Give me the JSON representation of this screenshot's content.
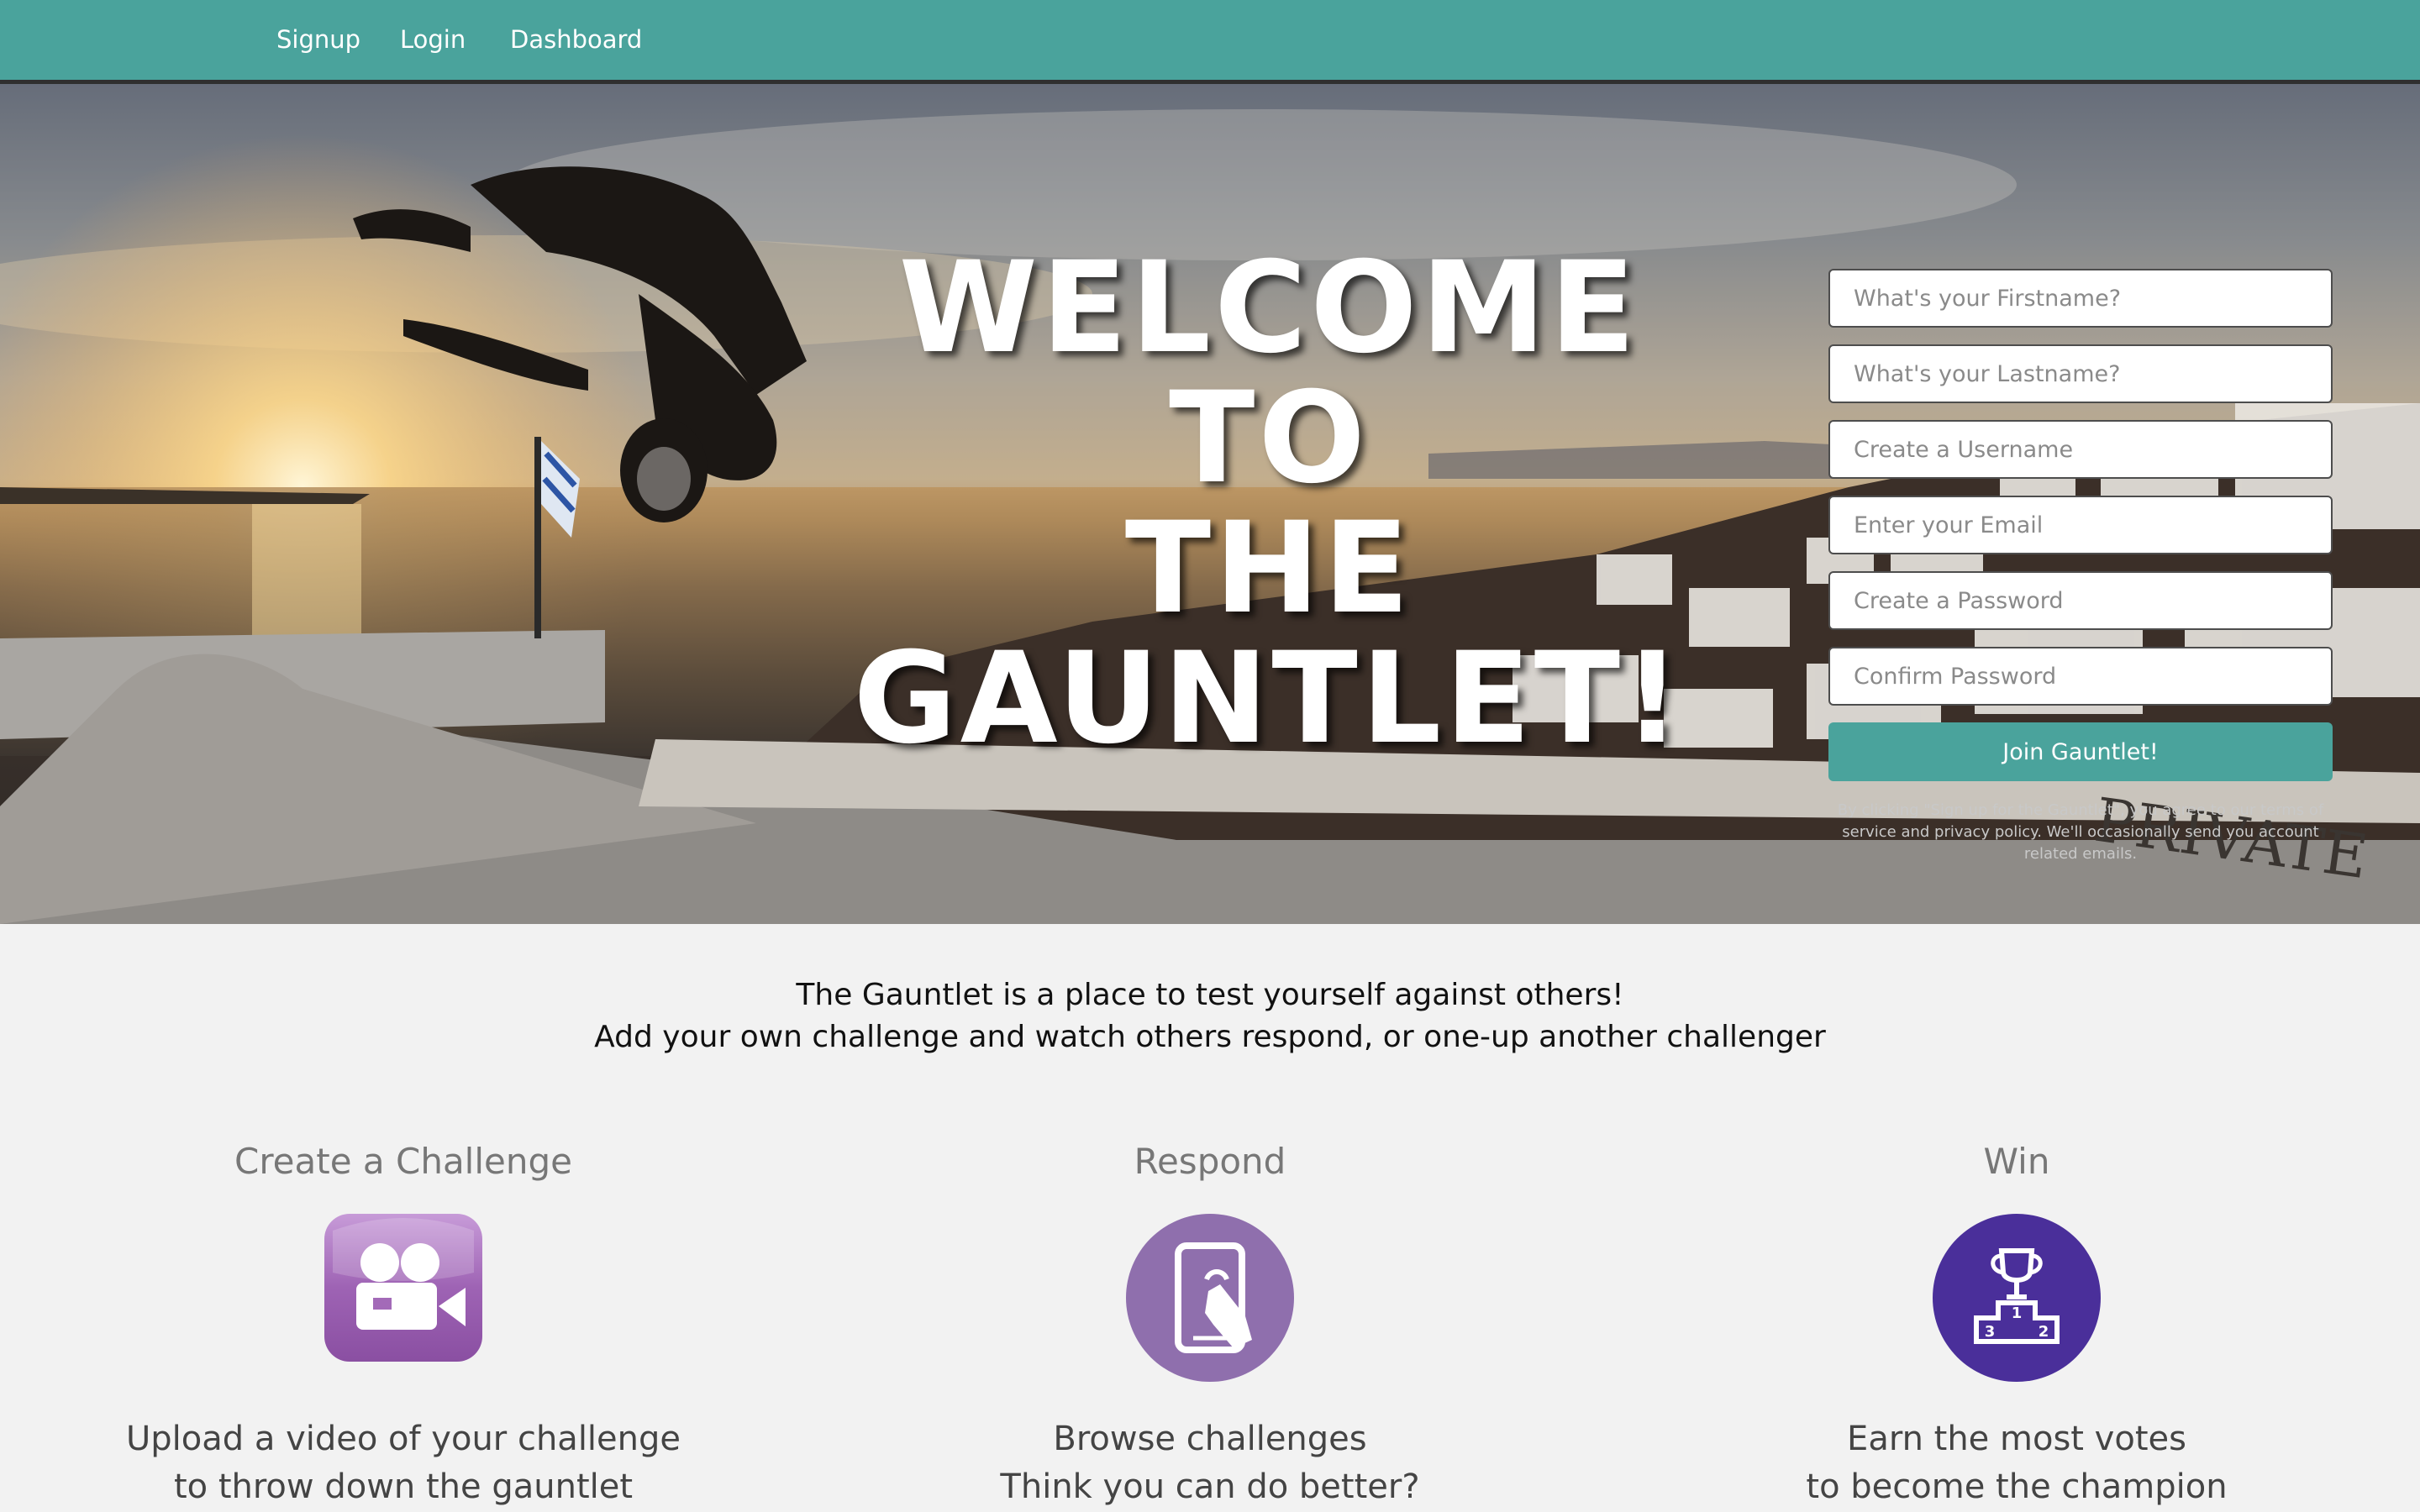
{
  "nav": {
    "links": [
      "Signup",
      "Login",
      "Dashboard"
    ]
  },
  "hero": {
    "title_lines": [
      "WELCOME TO",
      "THE",
      "GAUNTLET!"
    ]
  },
  "signup": {
    "firstname_placeholder": "What's your Firstname?",
    "lastname_placeholder": "What's your Lastname?",
    "username_placeholder": "Create a Username",
    "email_placeholder": "Enter your Email",
    "password_placeholder": "Create a Password",
    "confirm_placeholder": "Confirm Password",
    "submit_label": "Join Gauntlet!",
    "terms": "By clicking \"Sign up for the Gauntlet\", you agree to our terms of service and privacy policy. We'll occasionally send you account related emails."
  },
  "intro": {
    "lines": [
      "The Gauntlet is a place to test yourself against others!",
      "Add your own challenge and watch others respond, or one-up another challenger"
    ]
  },
  "features": [
    {
      "title": "Create a Challenge",
      "icon": "video-camera-icon",
      "desc_lines": [
        "Upload a video of your challenge",
        "to throw down the gauntlet"
      ]
    },
    {
      "title": "Respond",
      "icon": "tablet-touch-icon",
      "desc_lines": [
        "Browse challenges",
        "Think you can do better?"
      ]
    },
    {
      "title": "Win",
      "icon": "trophy-podium-icon",
      "desc_lines": [
        "Earn the most votes",
        "to become the champion"
      ]
    }
  ],
  "colors": {
    "navbar": "#4aa39c",
    "button": "#4aa39c",
    "icon_create": "#9b62b0",
    "icon_respond": "#8f6fad",
    "icon_win": "#4a2f9a"
  },
  "hero_image_text": "PRIVATE"
}
